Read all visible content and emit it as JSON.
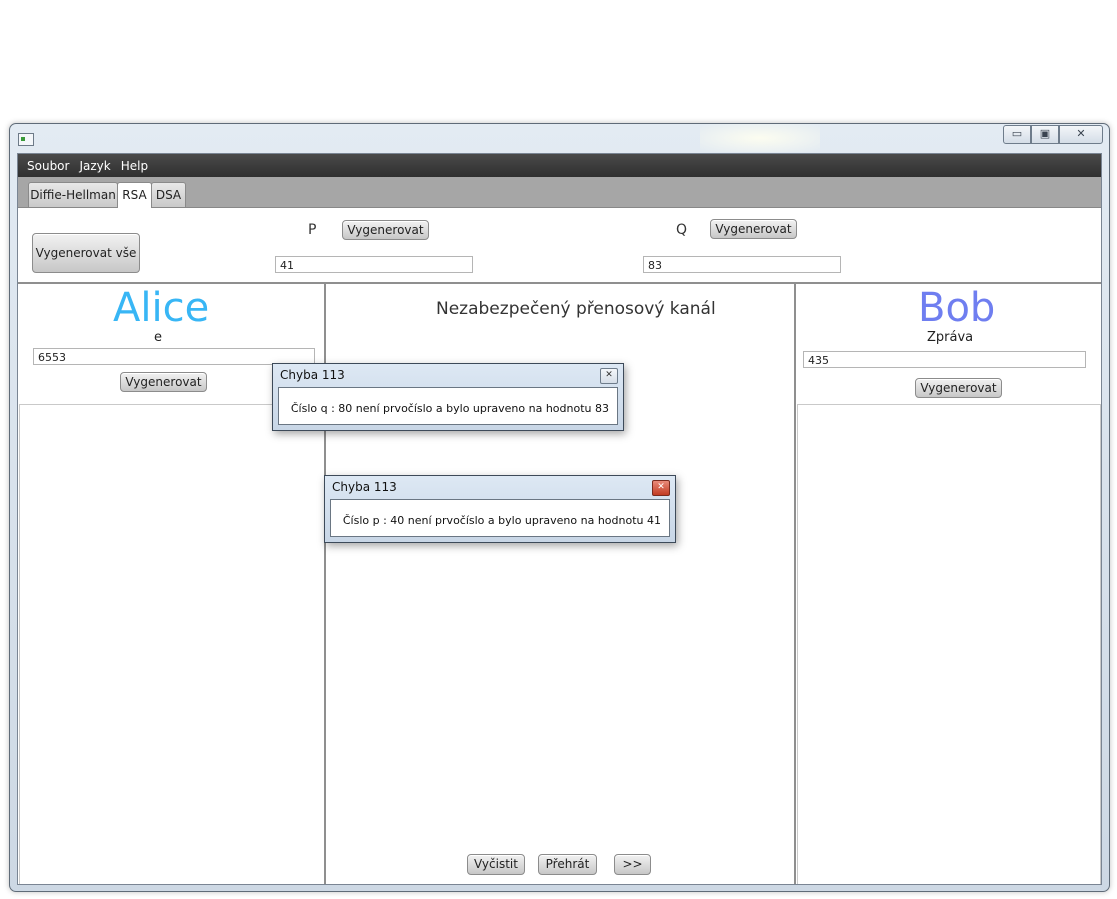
{
  "window": {
    "controls": {
      "minimize": "▭",
      "maximize": "▣",
      "close": "✕"
    }
  },
  "menu": {
    "items": [
      "Soubor",
      "Jazyk",
      "Help"
    ]
  },
  "tabs": [
    {
      "label": "Diffie-Hellman",
      "active": false
    },
    {
      "label": "RSA",
      "active": true
    },
    {
      "label": "DSA",
      "active": false
    }
  ],
  "top": {
    "generate_all_label": "Vygenerovat vše",
    "p_label": "P",
    "p_generate_label": "Vygenerovat",
    "p_value": "41",
    "q_label": "Q",
    "q_generate_label": "Vygenerovat",
    "q_value": "83"
  },
  "alice": {
    "title": "Alice",
    "title_color": "#38b6f5",
    "field_label": "e",
    "field_value": "6553",
    "generate_label": "Vygenerovat"
  },
  "channel": {
    "title": "Nezabezpečený přenosový kanál",
    "clear_label": "Vyčistit",
    "replay_label": "Přehrát",
    "next_label": ">>"
  },
  "bob": {
    "title": "Bob",
    "title_color": "#6f7ef0",
    "field_label": "Zpráva",
    "field_value": "435",
    "generate_label": "Vygenerovat"
  },
  "dialogs": [
    {
      "title": "Chyba 113",
      "message": "Číslo q : 80 není prvočíslo a bylo upraveno na hodnotu 83",
      "close": "✕"
    },
    {
      "title": "Chyba 113",
      "message": "Číslo p : 40 není prvočíslo a bylo upraveno na hodnotu 41",
      "close": "✕"
    }
  ]
}
